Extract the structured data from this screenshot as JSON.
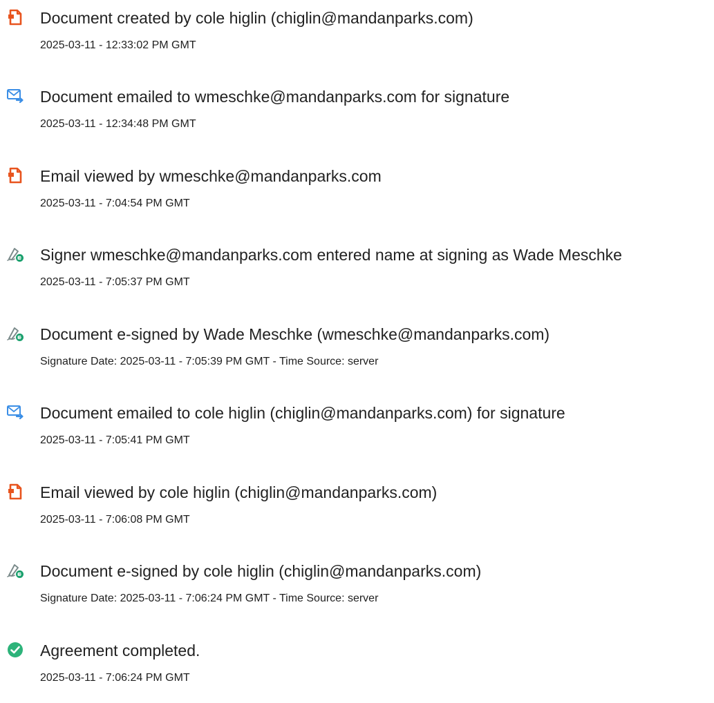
{
  "events": [
    {
      "icon": "document-orange-icon",
      "title": "Document created by cole higlin (chiglin@mandanparks.com)",
      "subtitle": "2025-03-11 - 12:33:02 PM GMT"
    },
    {
      "icon": "email-sent-icon",
      "title": "Document emailed to wmeschke@mandanparks.com for signature",
      "subtitle": "2025-03-11 - 12:34:48 PM GMT"
    },
    {
      "icon": "document-orange-icon",
      "title": "Email viewed by wmeschke@mandanparks.com",
      "subtitle": "2025-03-11 - 7:04:54 PM GMT"
    },
    {
      "icon": "esign-pen-icon",
      "title": "Signer wmeschke@mandanparks.com entered name at signing as Wade Meschke",
      "subtitle": "2025-03-11 - 7:05:37 PM GMT"
    },
    {
      "icon": "esign-pen-icon",
      "title": "Document e-signed by Wade Meschke (wmeschke@mandanparks.com)",
      "subtitle": "Signature Date: 2025-03-11 - 7:05:39 PM GMT - Time Source: server"
    },
    {
      "icon": "email-sent-icon",
      "title": "Document emailed to cole higlin (chiglin@mandanparks.com) for signature",
      "subtitle": "2025-03-11 - 7:05:41 PM GMT"
    },
    {
      "icon": "document-orange-icon",
      "title": "Email viewed by cole higlin (chiglin@mandanparks.com)",
      "subtitle": "2025-03-11 - 7:06:08 PM GMT"
    },
    {
      "icon": "esign-pen-icon",
      "title": "Document e-signed by cole higlin (chiglin@mandanparks.com)",
      "subtitle": "Signature Date: 2025-03-11 - 7:06:24 PM GMT - Time Source: server"
    },
    {
      "icon": "checkmark-circle-icon",
      "title": "Agreement completed.",
      "subtitle": "2025-03-11 - 7:06:24 PM GMT"
    }
  ],
  "colors": {
    "document_icon": "#e8541e",
    "email_icon": "#3a8ee6",
    "pen_icon": "#7a8a8a",
    "esign_badge": "#1aa06d",
    "check_icon": "#2db37a"
  }
}
